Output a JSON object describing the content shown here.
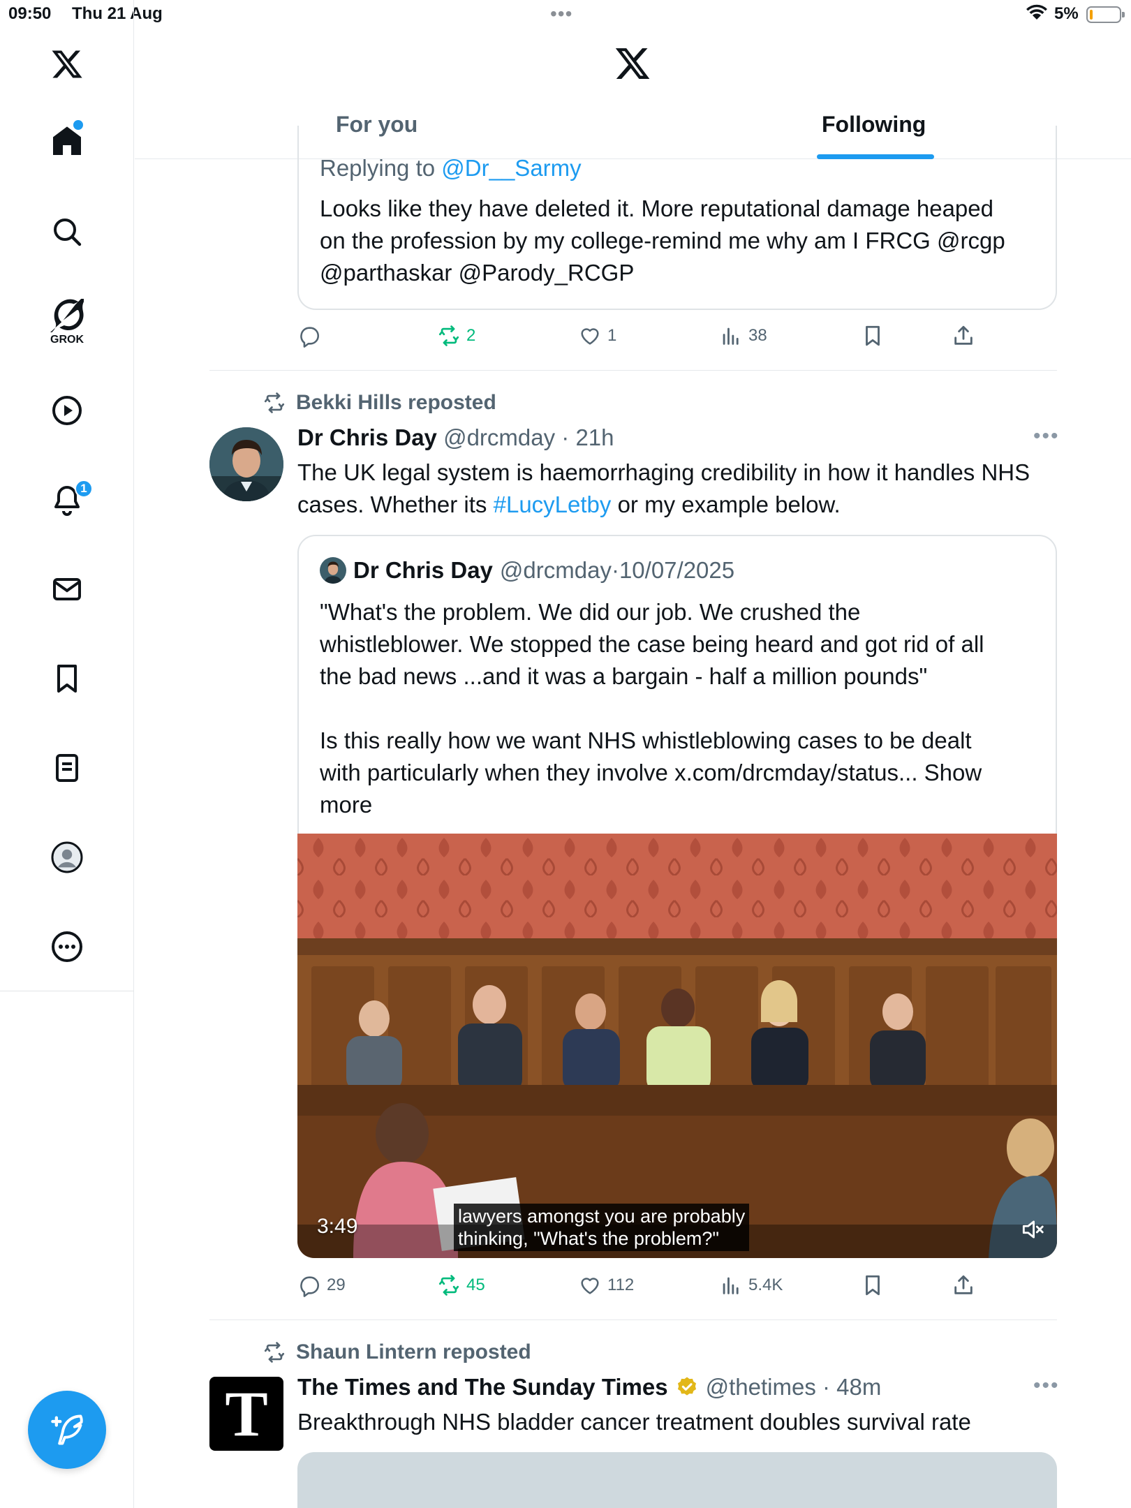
{
  "status_bar": {
    "time": "09:50",
    "date": "Thu 21 Aug",
    "battery": "5%"
  },
  "sidebar": {
    "items": [
      {
        "name": "x-logo-icon"
      },
      {
        "name": "home-icon",
        "has_dot": true
      },
      {
        "name": "search-icon"
      },
      {
        "name": "grok-icon",
        "label": "GROK"
      },
      {
        "name": "video-play-icon"
      },
      {
        "name": "notifications-bell-icon",
        "badge": "1"
      },
      {
        "name": "messages-envelope-icon"
      },
      {
        "name": "bookmarks-icon"
      },
      {
        "name": "lists-icon"
      },
      {
        "name": "profile-avatar-icon"
      },
      {
        "name": "more-circle-icon"
      }
    ],
    "compose_icon": "compose-post-icon"
  },
  "header": {
    "tabs": [
      {
        "label": "For you",
        "selected": false
      },
      {
        "label": "Following",
        "selected": true
      }
    ]
  },
  "tweet1": {
    "replying_prefix": "Replying to",
    "replying_to": "@Dr__Sarmy",
    "quote_lines": [
      "Looks like they have deleted it. More reputational damage heaped",
      "on the profession by my college-remind me why am I FRCG @rcgp",
      "@parthaskar @Parody_RCGP"
    ],
    "actions": {
      "replies": "",
      "reposts": "2",
      "likes": "1",
      "views": "38"
    }
  },
  "tweet2": {
    "reposted_by": "Bekki Hills reposted",
    "author_name": "Dr Chris Day",
    "handle": "@drcmday",
    "time": "21h",
    "text_before": "The UK legal system  is haemorrhaging credibility in how it handles NHS",
    "text_line2_before": "cases. Whether its ",
    "hashtag": "#LucyLetby",
    "text_line2_after": " or my example below.",
    "quote": {
      "author_name": "Dr Chris Day",
      "handle": "@drcmday",
      "date": "10/07/2025",
      "lines": [
        "\"What's the problem. We did our job. We crushed the",
        "whistleblower. We stopped the case being heard and got rid of all",
        "the bad news ...and it was a bargain - half a million pounds\"",
        "",
        "Is this really how we want NHS whistleblowing cases to be dealt",
        "with particularly when they involve x.com/drcmday/status... Show",
        "more"
      ]
    },
    "video": {
      "duration": "3:49",
      "caption_line1": "lawyers amongst you are probably",
      "caption_line2": "thinking, \"What's the problem?\""
    },
    "actions": {
      "replies": "29",
      "reposts": "45",
      "likes": "112",
      "views": "5.4K"
    }
  },
  "tweet3": {
    "reposted_by": "Shaun Lintern reposted",
    "author_name": "The Times and The Sunday Times",
    "handle": "@thetimes",
    "time": "48m",
    "avatar_letter": "T",
    "text": "Breakthrough NHS bladder cancer treatment doubles survival rate"
  },
  "colors": {
    "accent": "#1d9bf0",
    "repost_green": "#00ba7c",
    "muted": "#536471",
    "verified_gold": "#e2b719"
  }
}
